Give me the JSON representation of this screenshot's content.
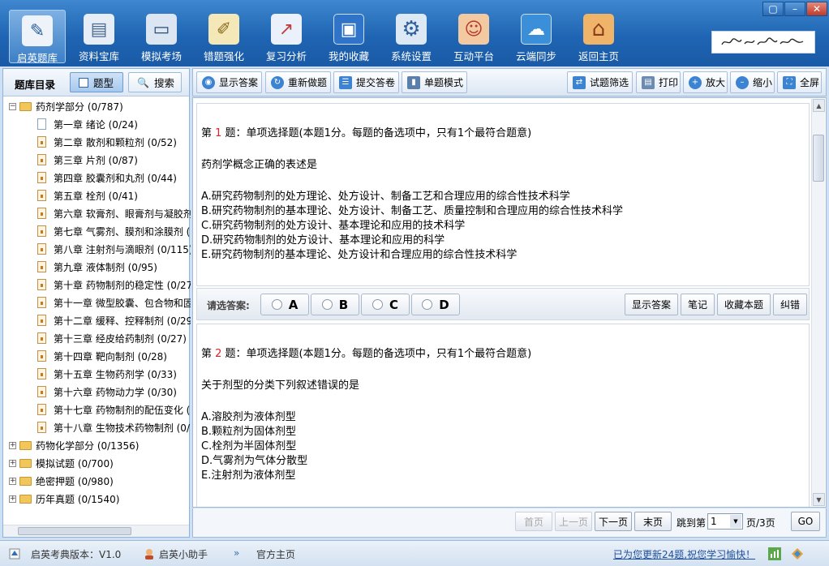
{
  "window": {
    "minimize_label": "–",
    "restore_label": "▢",
    "close_label": "✕"
  },
  "nav": [
    {
      "label": "启英题库",
      "icon": "pen-book-icon",
      "color": "#f2f4f7",
      "glyph": "✎"
    },
    {
      "label": "资料宝库",
      "icon": "books-icon",
      "color": "#e6edf6",
      "glyph": "▤"
    },
    {
      "label": "模拟考场",
      "icon": "computer-icon",
      "color": "#dce6f2",
      "glyph": "▭"
    },
    {
      "label": "错题强化",
      "icon": "notepad-icon",
      "color": "#f4e8b8",
      "glyph": "✐"
    },
    {
      "label": "复习分析",
      "icon": "chart-icon",
      "color": "#eaf1fa",
      "glyph": "↗"
    },
    {
      "label": "我的收藏",
      "icon": "floppy-icon",
      "color": "#2f74c9",
      "glyph": "▣"
    },
    {
      "label": "系统设置",
      "icon": "gear-icon",
      "color": "#dde8f5",
      "glyph": "⚙"
    },
    {
      "label": "互动平台",
      "icon": "people-icon",
      "color": "#f3c9a2",
      "glyph": "☺"
    },
    {
      "label": "云端同步",
      "icon": "cloud-sync-icon",
      "color": "#3a8fd8",
      "glyph": "☁"
    },
    {
      "label": "返回主页",
      "icon": "home-icon",
      "color": "#f0b36a",
      "glyph": "⌂"
    }
  ],
  "left": {
    "title": "题库目录",
    "tab_type": "题型",
    "tab_search": "搜索",
    "tree": [
      {
        "label": "药剂学部分 (0/787)",
        "level": 0,
        "kind": "folder",
        "expanded": true
      },
      {
        "label": "第一章  绪论 (0/24)",
        "level": 1,
        "kind": "doc"
      },
      {
        "label": "第二章  散剂和颗粒剂 (0/52)",
        "level": 1,
        "kind": "lock"
      },
      {
        "label": "第三章  片剂 (0/87)",
        "level": 1,
        "kind": "lock"
      },
      {
        "label": "第四章  胶囊剂和丸剂 (0/44)",
        "level": 1,
        "kind": "lock"
      },
      {
        "label": "第五章  栓剂 (0/41)",
        "level": 1,
        "kind": "lock"
      },
      {
        "label": "第六章  软膏剂、眼膏剂与凝胶剂",
        "level": 1,
        "kind": "lock"
      },
      {
        "label": "第七章  气雾剂、膜剂和涂膜剂 (",
        "level": 1,
        "kind": "lock"
      },
      {
        "label": "第八章  注射剂与滴眼剂 (0/115)",
        "level": 1,
        "kind": "lock"
      },
      {
        "label": "第九章  液体制剂 (0/95)",
        "level": 1,
        "kind": "lock"
      },
      {
        "label": "第十章  药物制剂的稳定性 (0/27",
        "level": 1,
        "kind": "lock"
      },
      {
        "label": "第十一章  微型胶囊、包合物和固",
        "level": 1,
        "kind": "lock"
      },
      {
        "label": "第十二章  缓释、控释制剂 (0/29",
        "level": 1,
        "kind": "lock"
      },
      {
        "label": "第十三章  经皮给药制剂 (0/27)",
        "level": 1,
        "kind": "lock"
      },
      {
        "label": "第十四章  靶向制剂 (0/28)",
        "level": 1,
        "kind": "lock"
      },
      {
        "label": "第十五章  生物药剂学 (0/33)",
        "level": 1,
        "kind": "lock"
      },
      {
        "label": "第十六章  药物动力学 (0/30)",
        "level": 1,
        "kind": "lock"
      },
      {
        "label": "第十七章  药物制剂的配伍变化 (",
        "level": 1,
        "kind": "lock"
      },
      {
        "label": "第十八章  生物技术药物制剂 (0/",
        "level": 1,
        "kind": "lock"
      },
      {
        "label": "药物化学部分 (0/1356)",
        "level": 0,
        "kind": "folder",
        "expanded": false
      },
      {
        "label": "模拟试题 (0/700)",
        "level": 0,
        "kind": "folder",
        "expanded": false
      },
      {
        "label": "绝密押题 (0/980)",
        "level": 0,
        "kind": "folder",
        "expanded": false
      },
      {
        "label": "历年真题 (0/1540)",
        "level": 0,
        "kind": "folder",
        "expanded": false
      }
    ]
  },
  "toolbar": {
    "show_answer": "显示答案",
    "redo": "重新做题",
    "submit": "提交答卷",
    "single_mode": "单题模式",
    "filter": "试题筛选",
    "print": "打印",
    "zoom_in": "放大",
    "zoom_out": "缩小",
    "fullscreen": "全屏"
  },
  "q1": {
    "prefix": "第 ",
    "num": "1",
    "header": " 题：单项选择题(本题1分。每题的备选项中，只有1个最符合题意)",
    "stem": "药剂学概念正确的表述是",
    "options": [
      "A.研究药物制剂的处方理论、处方设计、制备工艺和合理应用的综合性技术科学",
      "B.研究药物制剂的基本理论、处方设计、制备工艺、质量控制和合理应用的综合性技术科学",
      "C.研究药物制剂的处方设计、基本理论和应用的技术科学",
      "D.研究药物制剂的处方设计、基本理论和应用的科学",
      "E.研究药物制剂的基本理论、处方设计和合理应用的综合性技术科学"
    ]
  },
  "answer_bar": {
    "prompt": "请选答案:",
    "choices": [
      "A",
      "B",
      "C",
      "D"
    ],
    "show_answer": "显示答案",
    "note": "笔记",
    "favorite": "收藏本题",
    "report": "纠错"
  },
  "q2": {
    "prefix": "第 ",
    "num": "2",
    "header": " 题：单项选择题(本题1分。每题的备选项中，只有1个最符合题意)",
    "stem": "关于剂型的分类下列叙述错误的是",
    "options": [
      "A.溶胶剂为液体剂型",
      "B.颗粒剂为固体剂型",
      "C.栓剂为半固体剂型",
      "D.气雾剂为气体分散型",
      "E.注射剂为液体剂型"
    ]
  },
  "pager": {
    "first": "首页",
    "prev": "上一页",
    "next": "下一页",
    "last": "末页",
    "jump_label": "跳到第",
    "page_value": "1",
    "total": "页/3页",
    "go": "GO"
  },
  "status": {
    "version": "启英考典版本：V1.0",
    "assistant": "启英小助手",
    "homepage": "官方主页",
    "update_msg": "已为您更新24题,祝您学习愉快！"
  }
}
